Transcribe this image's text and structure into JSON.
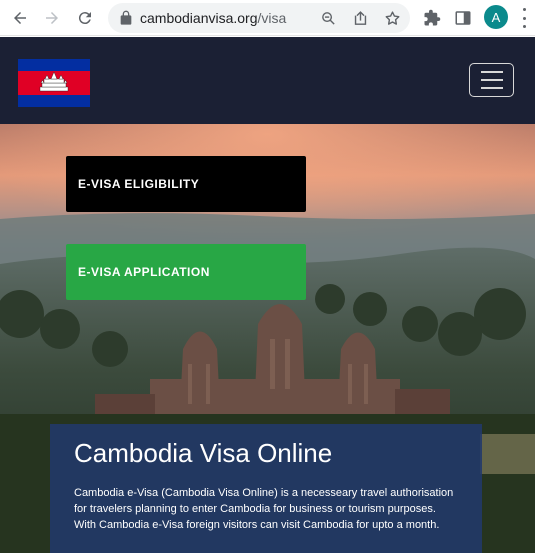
{
  "browser": {
    "url_domain": "cambodianvisa.org",
    "url_path": "/visa",
    "avatar_letter": "A",
    "icons": [
      "back-arrow-icon",
      "forward-arrow-icon",
      "reload-icon",
      "lock-icon",
      "zoom-icon",
      "share-icon",
      "star-icon",
      "extensions-icon",
      "side-panel-icon",
      "menu-kebab-icon"
    ]
  },
  "header": {
    "logo": "cambodia-flag",
    "menu_icon": "hamburger-icon",
    "colors": {
      "background": "#1b2034",
      "flag_blue": "#032ea1",
      "flag_red": "#e00025"
    }
  },
  "hero": {
    "buttons": {
      "eligibility": "E-VISA ELIGIBILITY",
      "application": "E-VISA APPLICATION"
    },
    "card": {
      "title": "Cambodia Visa Online",
      "text": "Cambodia e-Visa (Cambodia Visa Online) is a necesseary travel authorisation for travelers planning to enter Cambodia for business or tourism purposes. With Cambodia e-Visa foreign visitors can visit Cambodia for upto a month."
    },
    "colors": {
      "application_button": "#28a745",
      "eligibility_button": "#000000",
      "card": "#22396b"
    }
  }
}
